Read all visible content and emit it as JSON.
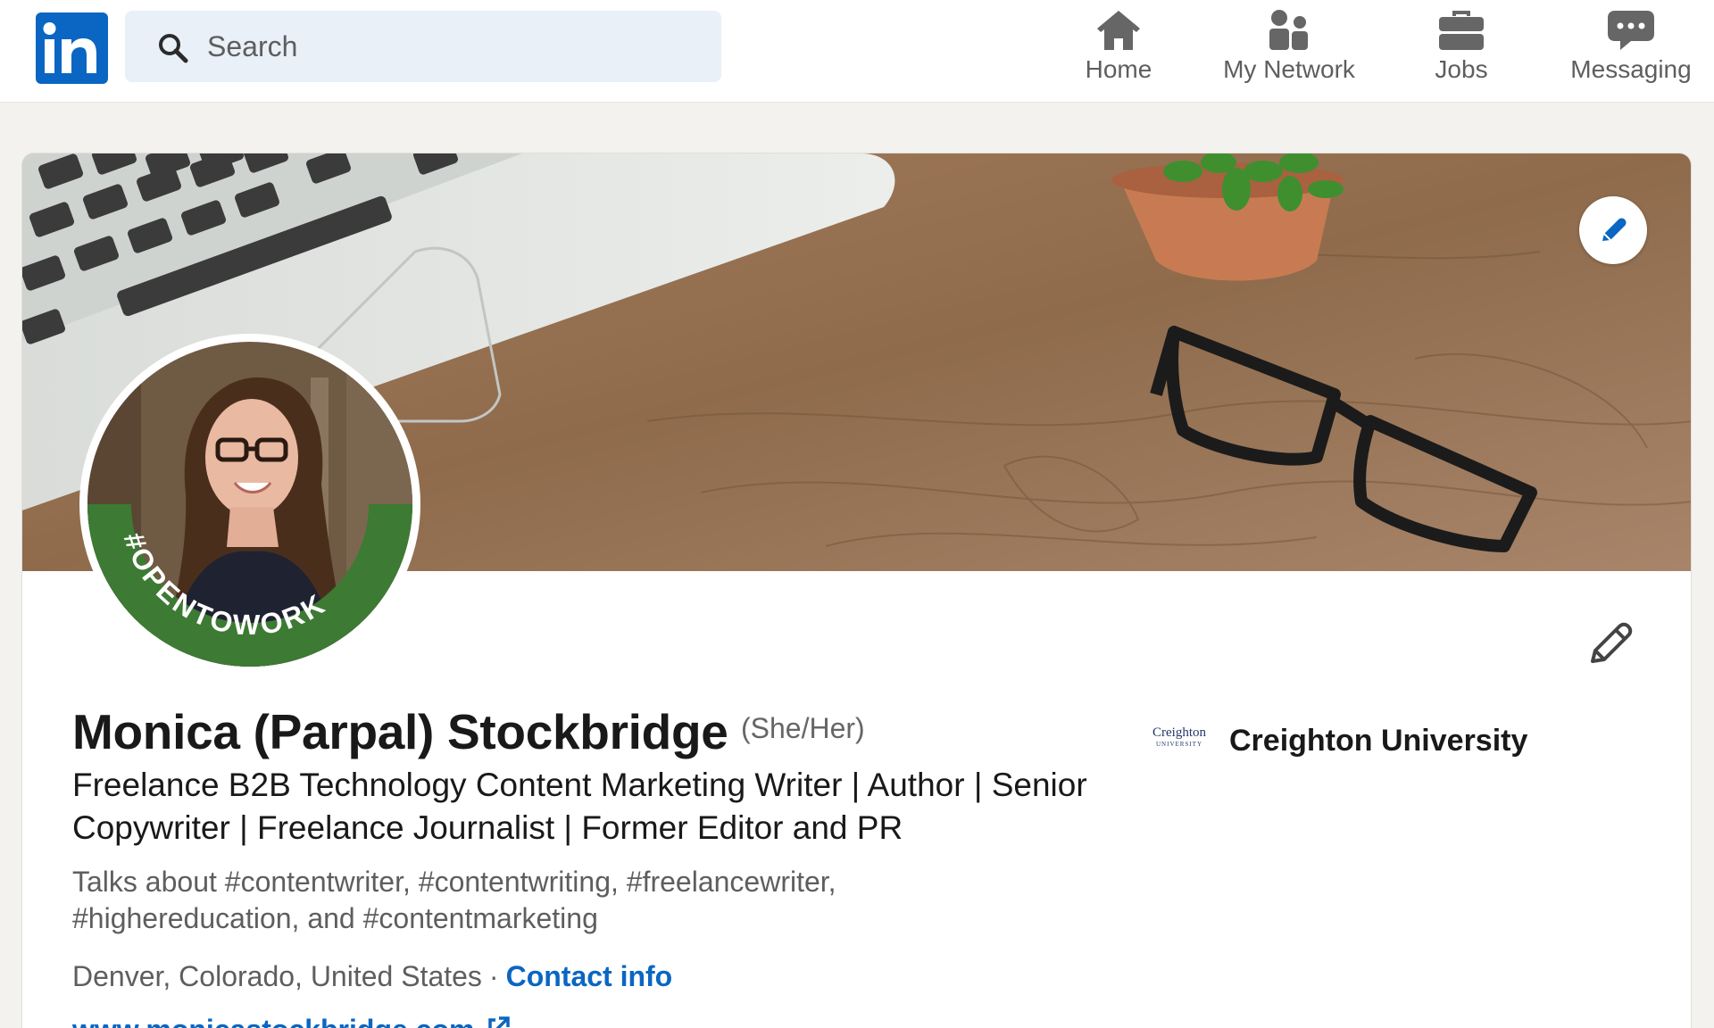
{
  "nav": {
    "logo_text": "in",
    "search": {
      "placeholder": "Search"
    },
    "items": [
      {
        "label": "Home",
        "icon": "home-icon"
      },
      {
        "label": "My Network",
        "icon": "network-icon"
      },
      {
        "label": "Jobs",
        "icon": "briefcase-icon"
      },
      {
        "label": "Messaging",
        "icon": "messaging-icon"
      }
    ]
  },
  "profile": {
    "name": "Monica (Parpal) Stockbridge",
    "pronouns": "(She/Her)",
    "headline": "Freelance B2B Technology Content Marketing Writer | Author | Senior Copywriter | Freelance Journalist | Former Editor and PR",
    "talks_about": "Talks about #contentwriter, #contentwriting, #freelancewriter, #highereducation, and #contentmarketing",
    "location": "Denver, Colorado, United States",
    "separator": "·",
    "contact_info_label": "Contact info",
    "website": "www.monicastockbridge.com",
    "open_to_work_badge": "#OPENTOWORK",
    "education": {
      "name": "Creighton University",
      "logo_text": "Creighton",
      "logo_subtext": "UNIVERSITY"
    }
  },
  "colors": {
    "brand_blue": "#0a66c2",
    "open_to_work_green": "#3d7a33",
    "page_background": "#f3f2ef",
    "muted_text": "#5e5e5e"
  }
}
